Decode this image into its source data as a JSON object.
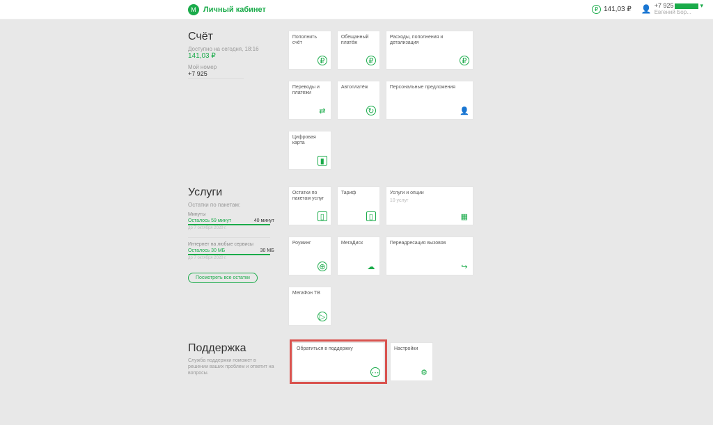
{
  "header": {
    "app_title": "Личный кабинет",
    "balance": "141,03 ₽",
    "user_phone_prefix": "+7 925",
    "user_name": "Евгений Бор..."
  },
  "account": {
    "title": "Счёт",
    "available_label": "Доступно на сегодня, 18:16",
    "balance": "141,03 ₽",
    "my_number_label": "Мой номер",
    "my_number": "+7 925",
    "cards": {
      "topup": "Пополнить счёт",
      "promised": "Обещанный платёж",
      "expenses": "Расходы, пополнения и детализация",
      "transfers": "Переводы и платежи",
      "autopay": "Автоплатёж",
      "personal": "Персональные предложения",
      "digital_card": "Цифровая карта"
    }
  },
  "services": {
    "title": "Услуги",
    "remaining_label": "Остатки по пакетам:",
    "minutes": {
      "label": "Минуты",
      "left": "Осталось 59 минут",
      "total": "40 минут",
      "date": "до 7 октября 2020 г."
    },
    "internet": {
      "label": "Интернет на любые сервисы",
      "left": "Осталось 30 МБ",
      "total": "30 МБ",
      "date": "до 7 октября 2020 г."
    },
    "view_all_btn": "Посмотреть все остатки",
    "cards": {
      "packages": "Остатки по пакетам услуг",
      "tariff": "Тариф",
      "options_title": "Услуги и опции",
      "options_count": "10 услуг",
      "roaming": "Роуминг",
      "megadisk": "МегаДиск",
      "call_forward": "Переадресация вызовов",
      "megafon_tv": "МегаФон ТВ"
    }
  },
  "support": {
    "title": "Поддержка",
    "desc": "Служба поддержки поможет в решении ваших проблем и ответит на вопросы.",
    "contact": "Обратиться в поддержку",
    "settings": "Настройки"
  }
}
